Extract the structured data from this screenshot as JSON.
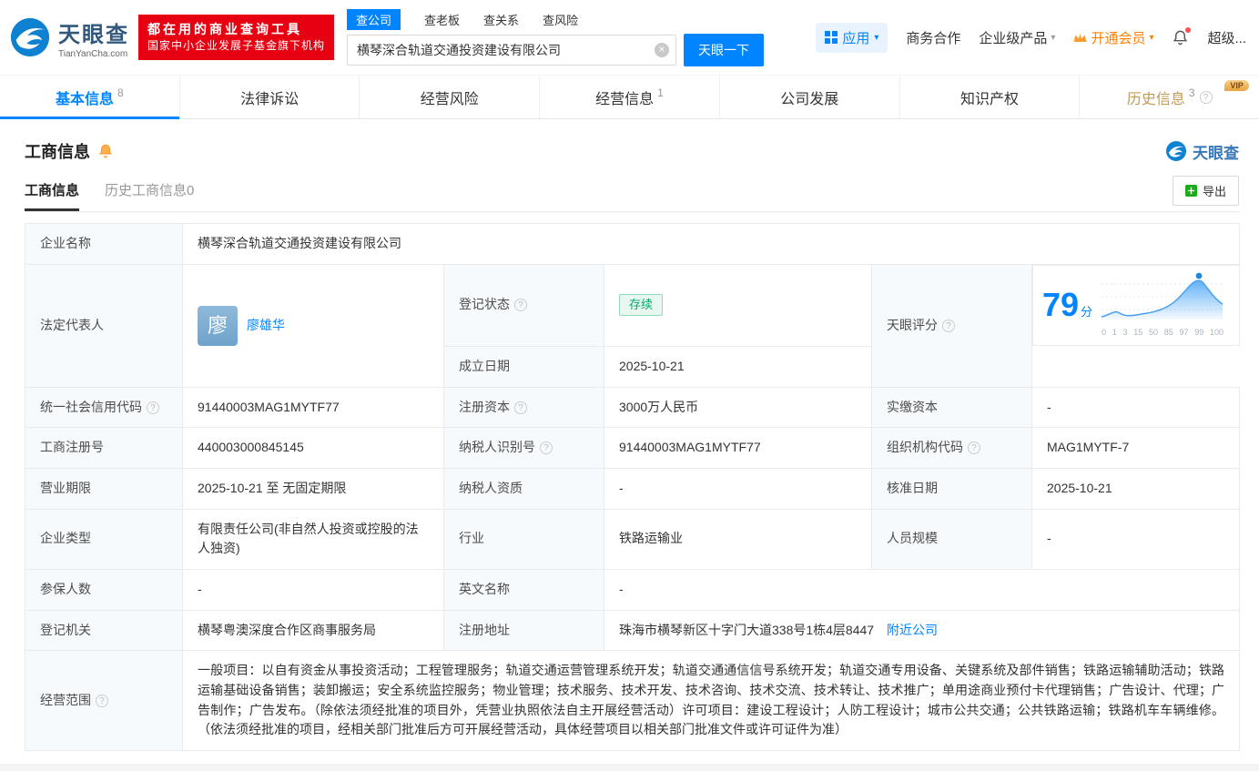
{
  "brand": {
    "name": "天眼查",
    "domain": "TianYanCha.com"
  },
  "promo": {
    "line1": "都在用的商业查询工具",
    "line2": "国家中小企业发展子基金旗下机构"
  },
  "search": {
    "tabs": [
      {
        "label": "查公司"
      },
      {
        "label": "查老板"
      },
      {
        "label": "查关系"
      },
      {
        "label": "查风险"
      }
    ],
    "value": "横琴深合轨道交通投资建设有限公司",
    "button": "天眼一下"
  },
  "header_right": {
    "apps": "应用",
    "cooperation": "商务合作",
    "enterprise": "企业级产品",
    "vip": "开通会员",
    "super": "超级..."
  },
  "nav": {
    "tabs": [
      {
        "label": "基本信息",
        "count": "8"
      },
      {
        "label": "法律诉讼",
        "count": ""
      },
      {
        "label": "经营风险",
        "count": ""
      },
      {
        "label": "经营信息",
        "count": "1"
      },
      {
        "label": "公司发展",
        "count": ""
      },
      {
        "label": "知识产权",
        "count": ""
      },
      {
        "label": "历史信息",
        "count": "3",
        "vip": "VIP"
      }
    ]
  },
  "section": {
    "title": "工商信息",
    "brand": "天眼查"
  },
  "subtabs": {
    "current": "工商信息",
    "history": "历史工商信息0",
    "export": "导出"
  },
  "info": {
    "labels": {
      "name": "企业名称",
      "legal_rep": "法定代表人",
      "reg_status": "登记状态",
      "est_date": "成立日期",
      "score": "天眼评分",
      "credit_code": "统一社会信用代码",
      "reg_capital": "注册资本",
      "paid_capital": "实缴资本",
      "reg_no": "工商注册号",
      "taxpayer_id": "纳税人识别号",
      "org_code": "组织机构代码",
      "term": "营业期限",
      "taxpayer_quali": "纳税人资质",
      "approval_date": "核准日期",
      "company_type": "企业类型",
      "industry": "行业",
      "staff_size": "人员规模",
      "insured": "参保人数",
      "english_name": "英文名称",
      "reg_authority": "登记机关",
      "address": "注册地址",
      "business_scope": "经营范围"
    },
    "values": {
      "name": "横琴深合轨道交通投资建设有限公司",
      "legal_rep": "廖雄华",
      "legal_rep_avatar": "廖",
      "reg_status": "存续",
      "est_date": "2025-10-21",
      "credit_code": "91440003MAG1MYTF77",
      "reg_capital": "3000万人民币",
      "paid_capital": "-",
      "reg_no": "440003000845145",
      "taxpayer_id": "91440003MAG1MYTF77",
      "org_code": "MAG1MYTF-7",
      "term": "2025-10-21 至 无固定期限",
      "taxpayer_quali": "-",
      "approval_date": "2025-10-21",
      "company_type": "有限责任公司(非自然人投资或控股的法人独资)",
      "industry": "铁路运输业",
      "staff_size": "-",
      "insured": "-",
      "english_name": "-",
      "reg_authority": "横琴粤澳深度合作区商事服务局",
      "address": "珠海市横琴新区十字门大道338号1栋4层8447",
      "address_link": "附近公司",
      "business_scope": "一般项目：以自有资金从事投资活动；工程管理服务；轨道交通运营管理系统开发；轨道交通通信信号系统开发；轨道交通专用设备、关键系统及部件销售；铁路运输辅助活动；铁路运输基础设备销售；装卸搬运；安全系统监控服务；物业管理；技术服务、技术开发、技术咨询、技术交流、技术转让、技术推广；单用途商业预付卡代理销售；广告设计、代理；广告制作；广告发布。（除依法须经批准的项目外，凭营业执照依法自主开展经营活动）许可项目：建设工程设计；人防工程设计；城市公共交通；公共铁路运输；铁路机车车辆维修。（依法须经批准的项目，经相关部门批准后方可开展经营活动，具体经营项目以相关部门批准文件或许可证件为准）"
    }
  },
  "score": {
    "value": "79",
    "unit": "分",
    "ticks": [
      "0",
      "1",
      "3",
      "15",
      "50",
      "85",
      "97",
      "99",
      "100"
    ]
  }
}
